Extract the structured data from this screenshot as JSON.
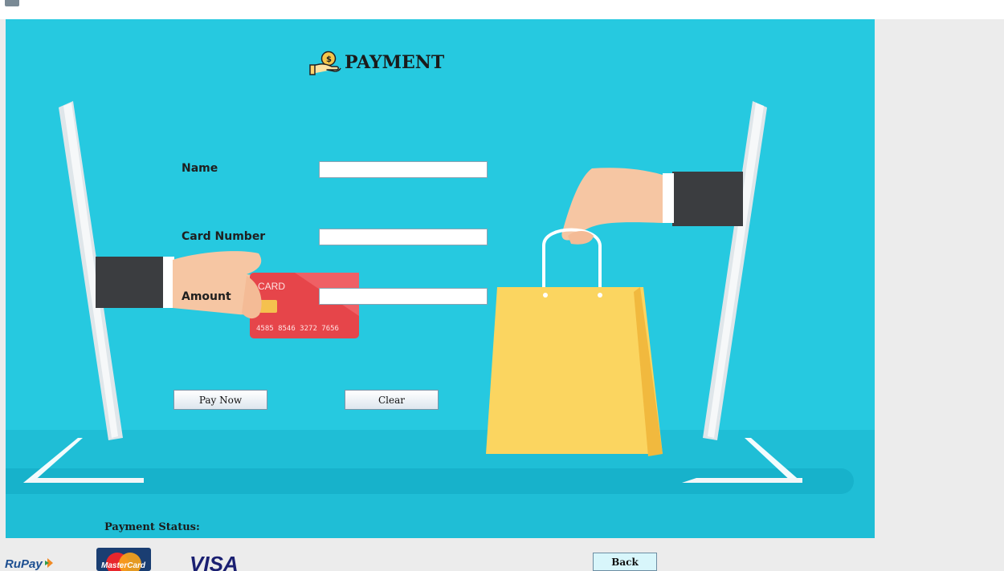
{
  "window": {
    "title": ""
  },
  "header": {
    "title": "PAYMENT",
    "icon": "money-hand-icon"
  },
  "form": {
    "name_label": "Name",
    "card_number_label": "Card Number",
    "amount_label": "Amount",
    "name_value": "",
    "card_number_value": "",
    "amount_value": "",
    "pay_button": "Pay Now",
    "clear_button": "Clear"
  },
  "illustration": {
    "card_title": "CARD",
    "card_number": "4585 8546 3272 7656"
  },
  "status": {
    "label": "Payment Status:",
    "value": ""
  },
  "footer": {
    "logos": [
      "RuPay",
      "MasterCard",
      "VISA"
    ],
    "back_button": "Back"
  },
  "colors": {
    "background": "#26c9e0",
    "card": "#e6454a",
    "bag": "#fbd560",
    "sleeve": "#3b3d40"
  }
}
